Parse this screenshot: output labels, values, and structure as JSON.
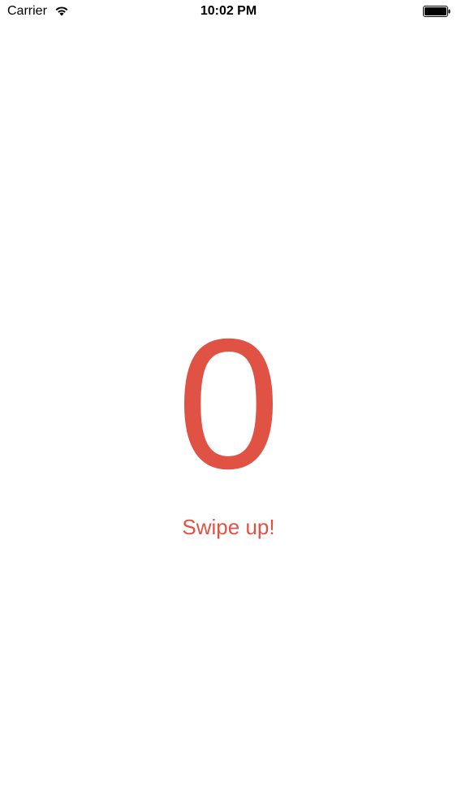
{
  "status_bar": {
    "carrier": "Carrier",
    "time": "10:02 PM",
    "wifi_icon": "wifi-icon",
    "battery_icon": "battery-icon"
  },
  "main": {
    "counter_value": "0",
    "hint_text": "Swipe up!"
  },
  "colors": {
    "accent": "#e05243",
    "background": "#ffffff",
    "status_text": "#000000"
  }
}
